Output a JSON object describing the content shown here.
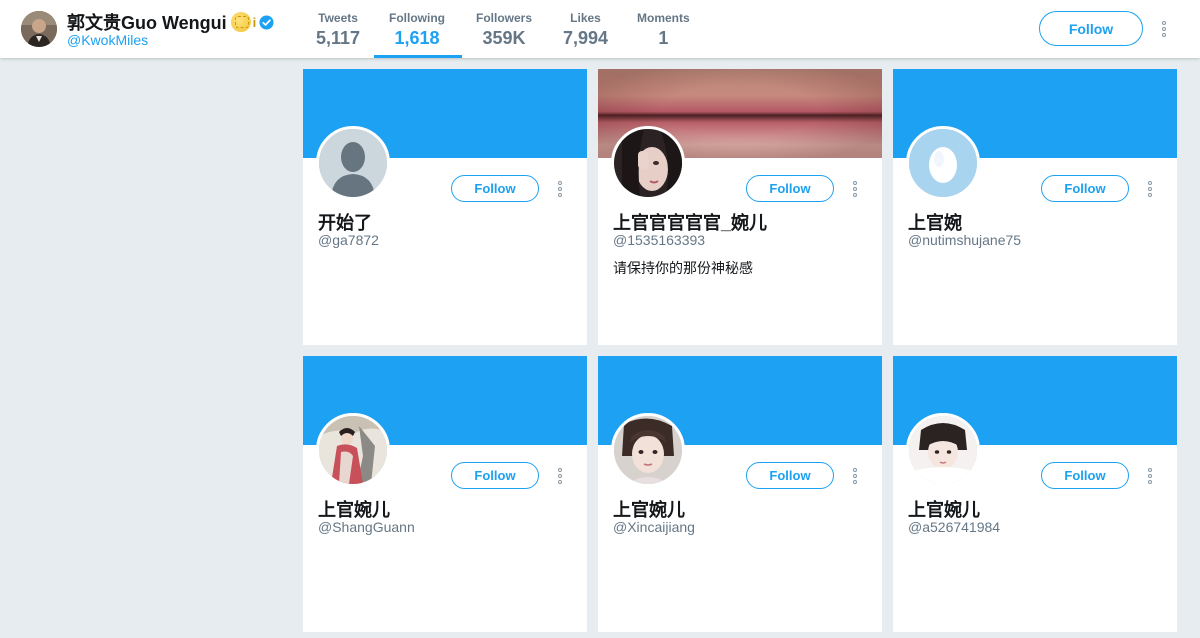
{
  "profile": {
    "name": "郭文贵Guo Wengui",
    "name_suffix": "i",
    "handle": "@KwokMiles",
    "follow_label": "Follow"
  },
  "stats": [
    {
      "label": "Tweets",
      "value": "5,117"
    },
    {
      "label": "Following",
      "value": "1,618"
    },
    {
      "label": "Followers",
      "value": "359K"
    },
    {
      "label": "Likes",
      "value": "7,994"
    },
    {
      "label": "Moments",
      "value": "1"
    }
  ],
  "active_stat": "Following",
  "cards": [
    {
      "name": "开始了",
      "handle": "@ga7872",
      "bio": "",
      "follow_label": "Follow",
      "avatar": "default-avatar-icon",
      "banner": "blue"
    },
    {
      "name": "上官官官官官_婉儿",
      "handle": "@1535163393",
      "bio": "请保持你的那份神秘感",
      "follow_label": "Follow",
      "avatar": "photo-woman",
      "banner": "lips-photo"
    },
    {
      "name": "上官婉",
      "handle": "@nutimshujane75",
      "bio": "",
      "follow_label": "Follow",
      "avatar": "egg-icon",
      "banner": "blue"
    },
    {
      "name": "上官婉儿",
      "handle": "@ShangGuann",
      "bio": "",
      "follow_label": "Follow",
      "avatar": "painting",
      "banner": "blue"
    },
    {
      "name": "上官婉儿",
      "handle": "@Xincaijiang",
      "bio": "",
      "follow_label": "Follow",
      "avatar": "photo-girl",
      "banner": "blue"
    },
    {
      "name": "上官婉儿",
      "handle": "@a526741984",
      "bio": "",
      "follow_label": "Follow",
      "avatar": "photo-girl-2",
      "banner": "blue"
    }
  ],
  "colors": {
    "accent": "#1da1f2",
    "background": "#e6ecf0",
    "muted": "#657786"
  }
}
